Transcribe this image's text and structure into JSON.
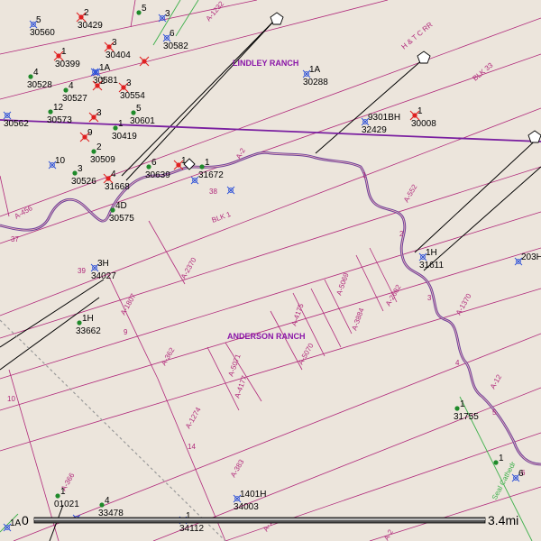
{
  "map": {
    "ranches": [
      {
        "name": "LINDLEY RANCH"
      },
      {
        "name": "ANDERSON RANCH"
      }
    ],
    "railroad_label": "H & T C RR",
    "block_labels": [
      "BLK 33",
      "BLK 1"
    ],
    "road_label": "Seal Cathedr",
    "scale": {
      "start": "0",
      "end": "3.4mi"
    },
    "colors": {
      "background": "#ece5dc",
      "survey_line": "#b0287a",
      "road": "#000000",
      "river": "#6a3d9a",
      "county_line": "#7a1fa0",
      "rail": "#9a9a9a",
      "green_line": "#3cb04a"
    },
    "survey_labels": [
      "A-1232",
      "A-456",
      "37",
      "38",
      "39",
      "A-2370",
      "A-1807",
      "9",
      "A-362",
      "10",
      "A-5071",
      "A-4177",
      "A-1274",
      "14",
      "A-383",
      "A-366",
      "A-5070",
      "A-4175",
      "A-5069",
      "A-3884",
      "A-2682",
      "1",
      "2",
      "3",
      "4",
      "5",
      "A-552",
      "A-1370",
      "A-12",
      "A-2",
      "A-1",
      "6",
      "A-2"
    ],
    "wells": [
      {
        "top": "5",
        "bottom": "30560",
        "icon": "gas",
        "color": "blue"
      },
      {
        "top": "2",
        "bottom": "30429",
        "icon": "dry",
        "color": "red"
      },
      {
        "top": "5",
        "bottom": "",
        "icon": "oil",
        "color": "green"
      },
      {
        "top": "3",
        "bottom": "",
        "icon": "gas",
        "color": "blue"
      },
      {
        "top": "6",
        "bottom": "30582",
        "icon": "gas",
        "color": "blue"
      },
      {
        "top": "1",
        "bottom": "30399",
        "icon": "dry",
        "color": "red"
      },
      {
        "top": "3",
        "bottom": "30404",
        "icon": "dry",
        "color": "red"
      },
      {
        "top": "",
        "bottom": "",
        "icon": "gas",
        "color": "blue"
      },
      {
        "top": "",
        "bottom": "",
        "icon": "dry",
        "color": "red"
      },
      {
        "top": "4",
        "bottom": "30528",
        "icon": "oil",
        "color": "green"
      },
      {
        "top": "1A",
        "bottom": "30581",
        "icon": "gas",
        "color": "blue"
      },
      {
        "top": "4",
        "bottom": "30527",
        "icon": "oil",
        "color": "green"
      },
      {
        "top": "2",
        "bottom": "",
        "icon": "dry",
        "color": "red"
      },
      {
        "top": "3",
        "bottom": "30554",
        "icon": "dry",
        "color": "red"
      },
      {
        "top": "1A",
        "bottom": "30288",
        "icon": "gas",
        "color": "blue"
      },
      {
        "top": "12",
        "bottom": "30573",
        "icon": "oil",
        "color": "green"
      },
      {
        "top": "",
        "bottom": "30562",
        "icon": "gas",
        "color": "blue"
      },
      {
        "top": "3",
        "bottom": "",
        "icon": "dry",
        "color": "red"
      },
      {
        "top": "5",
        "bottom": "30601",
        "icon": "oil",
        "color": "green"
      },
      {
        "top": "1",
        "bottom": "30419",
        "icon": "oil",
        "color": "green"
      },
      {
        "top": "9",
        "bottom": "",
        "icon": "dry",
        "color": "red"
      },
      {
        "top": "1",
        "bottom": "30008",
        "icon": "dry",
        "color": "red"
      },
      {
        "top": "2",
        "bottom": "30509",
        "icon": "oil",
        "color": "green"
      },
      {
        "top": "9301BH",
        "bottom": "32429",
        "icon": "gas",
        "color": "blue"
      },
      {
        "top": "10",
        "bottom": "",
        "icon": "gas",
        "color": "blue"
      },
      {
        "top": "6",
        "bottom": "30639",
        "icon": "oil",
        "color": "green"
      },
      {
        "top": "1",
        "bottom": "",
        "icon": "dry",
        "color": "red"
      },
      {
        "top": "1",
        "bottom": "31672",
        "icon": "oil",
        "color": "green"
      },
      {
        "top": "3",
        "bottom": "30526",
        "icon": "oil",
        "color": "green"
      },
      {
        "top": "4",
        "bottom": "31668",
        "icon": "dry",
        "color": "red"
      },
      {
        "top": "",
        "bottom": "",
        "icon": "gas",
        "color": "blue"
      },
      {
        "top": "",
        "bottom": "",
        "icon": "gas",
        "color": "blue"
      },
      {
        "top": "4D",
        "bottom": "30575",
        "icon": "oil",
        "color": "green"
      },
      {
        "top": "1H",
        "bottom": "31611",
        "icon": "gas",
        "color": "blue"
      },
      {
        "top": "203H",
        "bottom": "",
        "icon": "gas",
        "color": "blue"
      },
      {
        "top": "3H",
        "bottom": "34027",
        "icon": "gas",
        "color": "blue"
      },
      {
        "top": "1H",
        "bottom": "33662",
        "icon": "oil",
        "color": "green"
      },
      {
        "top": "1",
        "bottom": "31755",
        "icon": "oil",
        "color": "green"
      },
      {
        "top": "1",
        "bottom": "",
        "icon": "oil",
        "color": "green"
      },
      {
        "top": "6",
        "bottom": "",
        "icon": "gas",
        "color": "blue"
      },
      {
        "top": "1",
        "bottom": "01021",
        "icon": "oil",
        "color": "green"
      },
      {
        "top": "4",
        "bottom": "33478",
        "icon": "oil",
        "color": "green"
      },
      {
        "top": "1401H",
        "bottom": "34003",
        "icon": "gas",
        "color": "blue"
      },
      {
        "top": "1",
        "bottom": "34112",
        "icon": "gas",
        "color": "blue"
      },
      {
        "top": "1A",
        "bottom": "",
        "icon": "gas",
        "color": "blue"
      },
      {
        "top": "",
        "bottom": "",
        "icon": "gas",
        "color": "blue"
      }
    ]
  }
}
